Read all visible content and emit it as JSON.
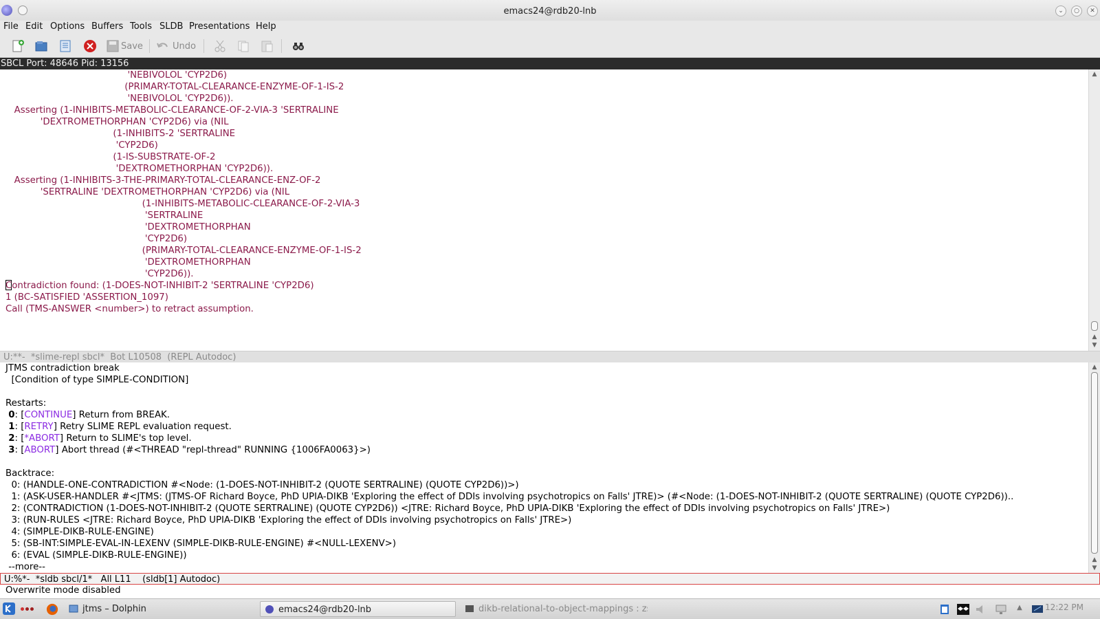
{
  "window": {
    "title": "emacs24@rdb20-lnb"
  },
  "menu": [
    "File",
    "Edit",
    "Options",
    "Buffers",
    "Tools",
    "SLDB",
    "Presentations",
    "Help"
  ],
  "toolbar": {
    "save_label": "Save",
    "undo_label": "Undo"
  },
  "header_line": "SBCL  Port: 48646  Pid: 13156",
  "repl_lines": [
    "                                          'NEBIVOLOL 'CYP2D6)",
    "                                         (PRIMARY-TOTAL-CLEARANCE-ENZYME-OF-1-IS-2",
    "                                          'NEBIVOLOL 'CYP2D6)).",
    "   Asserting (1-INHIBITS-METABOLIC-CLEARANCE-OF-2-VIA-3 'SERTRALINE",
    "            'DEXTROMETHORPHAN 'CYP2D6) via (NIL",
    "                                     (1-INHIBITS-2 'SERTRALINE",
    "                                      'CYP2D6)",
    "                                     (1-IS-SUBSTRATE-OF-2",
    "                                      'DEXTROMETHORPHAN 'CYP2D6)).",
    "   Asserting (1-INHIBITS-3-THE-PRIMARY-TOTAL-CLEARANCE-ENZ-OF-2",
    "            'SERTRALINE 'DEXTROMETHORPHAN 'CYP2D6) via (NIL",
    "                                               (1-INHIBITS-METABOLIC-CLEARANCE-OF-2-VIA-3",
    "                                                'SERTRALINE",
    "                                                'DEXTROMETHORPHAN",
    "                                                'CYP2D6)",
    "                                               (PRIMARY-TOTAL-CLEARANCE-ENZYME-OF-1-IS-2",
    "                                                'DEXTROMETHORPHAN",
    "                                                'CYP2D6)).",
    "Contradiction found: (1-DOES-NOT-INHIBIT-2 'SERTRALINE 'CYP2D6)",
    "1 (BC-SATISFIED 'ASSERTION_1097)",
    "Call (TMS-ANSWER <number>) to retract assumption."
  ],
  "repl_modeline": "U:**-  *slime-repl sbcl*  Bot L10508  (REPL Autodoc)",
  "sldb": {
    "title": "JTMS contradiction break",
    "condition": "  [Condition of type SIMPLE-CONDITION]",
    "restarts_header": "Restarts:",
    "restarts": [
      {
        "num": "0",
        "name": "CONTINUE",
        "desc": "Return from BREAK."
      },
      {
        "num": "1",
        "name": "RETRY",
        "desc": "Retry SLIME REPL evaluation request."
      },
      {
        "num": "2",
        "name": "*ABORT",
        "desc": "Return to SLIME's top level."
      },
      {
        "num": "3",
        "name": "ABORT",
        "desc": "Abort thread (#<THREAD \"repl-thread\" RUNNING {1006FA0063}>)"
      }
    ],
    "backtrace_header": "Backtrace:",
    "backtrace": [
      "  0: (HANDLE-ONE-CONTRADICTION #<Node: (1-DOES-NOT-INHIBIT-2 (QUOTE SERTRALINE) (QUOTE CYP2D6))>)",
      "  1: (ASK-USER-HANDLER #<JTMS: (JTMS-OF Richard Boyce, PhD UPIA-DIKB 'Exploring the effect of DDIs involving psychotropics on Falls' JTRE)> (#<Node: (1-DOES-NOT-INHIBIT-2 (QUOTE SERTRALINE) (QUOTE CYP2D6))..",
      "  2: (CONTRADICTION (1-DOES-NOT-INHIBIT-2 (QUOTE SERTRALINE) (QUOTE CYP2D6)) <JTRE: Richard Boyce, PhD UPIA-DIKB 'Exploring the effect of DDIs involving psychotropics on Falls' JTRE>)",
      "  3: (RUN-RULES <JTRE: Richard Boyce, PhD UPIA-DIKB 'Exploring the effect of DDIs involving psychotropics on Falls' JTRE>)",
      "  4: (SIMPLE-DIKB-RULE-ENGINE)",
      "  5: (SB-INT:SIMPLE-EVAL-IN-LEXENV (SIMPLE-DIKB-RULE-ENGINE) #<NULL-LEXENV>)",
      "  6: (EVAL (SIMPLE-DIKB-RULE-ENGINE))"
    ],
    "more": " --more--"
  },
  "sldb_modeline": "U:%*-  *sldb sbcl/1*   All L11    (sldb[1] Autodoc)",
  "echo": "Overwrite mode disabled",
  "taskbar": {
    "tasks": [
      {
        "label": "jtms – Dolphin"
      },
      {
        "label": "emacs24@rdb20-lnb"
      },
      {
        "label": "dikb-relational-to-object-mappings : zsh"
      }
    ],
    "clock": "12:22 PM"
  },
  "colors": {
    "repl_text": "#8b1a4a",
    "restart_keyword": "#8b2be2",
    "header_bg": "#2b2b2b",
    "active_modeline_border": "#d84444"
  }
}
